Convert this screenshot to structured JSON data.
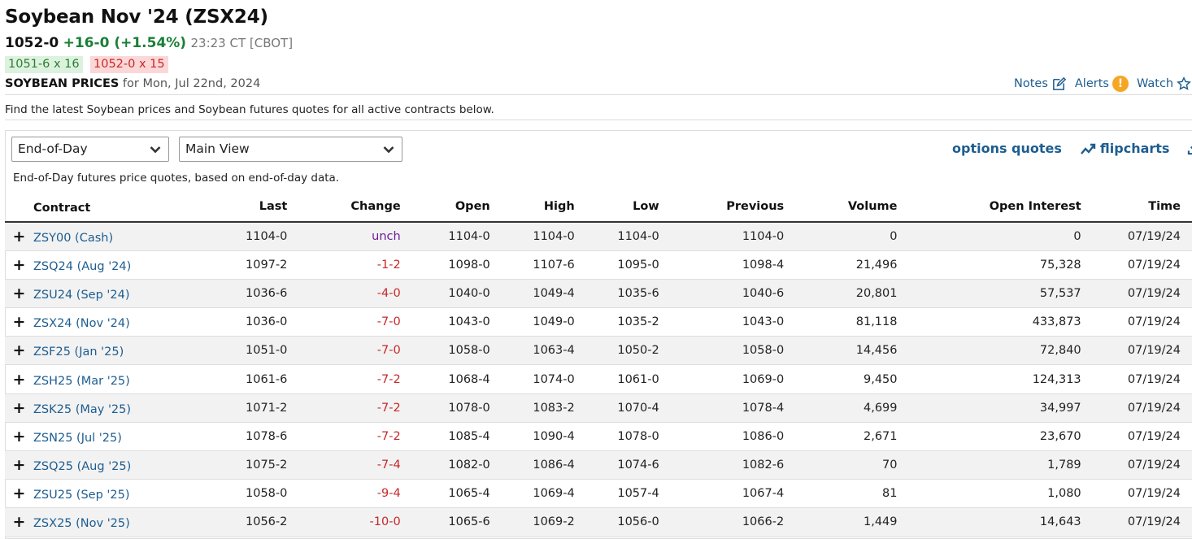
{
  "header": {
    "title": "Soybean Nov '24 (ZSX24)",
    "last": "1052-0",
    "change": "+16-0 (+1.54%)",
    "time": "23:23 CT [CBOT]",
    "bid": "1051-6 x 16",
    "ask": "1052-0 x 15",
    "prices_label": "SOYBEAN PRICES",
    "prices_date": "for Mon, Jul 22nd, 2024"
  },
  "actions": {
    "notes": "Notes",
    "alerts": "Alerts",
    "alerts_badge": "!",
    "watch": "Watch"
  },
  "intro": "Find the latest Soybean prices and Soybean futures quotes for all active contracts below.",
  "controls": {
    "data_select": "End-of-Day",
    "view_select": "Main View",
    "options_quotes": "options quotes",
    "flipcharts": "flipcharts",
    "download": "d"
  },
  "description": "End-of-Day futures price quotes, based on end-of-day data.",
  "colors": {
    "link": "#1d5d90",
    "negative": "#c62828",
    "positive": "#1a7f37",
    "unch": "#6a1b9a"
  },
  "table": {
    "headers": [
      "Contract",
      "Last",
      "Change",
      "Open",
      "High",
      "Low",
      "Previous",
      "Volume",
      "Open Interest",
      "Time"
    ],
    "rows": [
      {
        "contract": "ZSY00 (Cash)",
        "last": "1104-0",
        "change": "unch",
        "open": "1104-0",
        "high": "1104-0",
        "low": "1104-0",
        "previous": "1104-0",
        "volume": "0",
        "open_interest": "0",
        "time": "07/19/24"
      },
      {
        "contract": "ZSQ24 (Aug '24)",
        "last": "1097-2",
        "change": "-1-2",
        "open": "1098-0",
        "high": "1107-6",
        "low": "1095-0",
        "previous": "1098-4",
        "volume": "21,496",
        "open_interest": "75,328",
        "time": "07/19/24"
      },
      {
        "contract": "ZSU24 (Sep '24)",
        "last": "1036-6",
        "change": "-4-0",
        "open": "1040-0",
        "high": "1049-4",
        "low": "1035-6",
        "previous": "1040-6",
        "volume": "20,801",
        "open_interest": "57,537",
        "time": "07/19/24"
      },
      {
        "contract": "ZSX24 (Nov '24)",
        "last": "1036-0",
        "change": "-7-0",
        "open": "1043-0",
        "high": "1049-0",
        "low": "1035-2",
        "previous": "1043-0",
        "volume": "81,118",
        "open_interest": "433,873",
        "time": "07/19/24"
      },
      {
        "contract": "ZSF25 (Jan '25)",
        "last": "1051-0",
        "change": "-7-0",
        "open": "1058-0",
        "high": "1063-4",
        "low": "1050-2",
        "previous": "1058-0",
        "volume": "14,456",
        "open_interest": "72,840",
        "time": "07/19/24"
      },
      {
        "contract": "ZSH25 (Mar '25)",
        "last": "1061-6",
        "change": "-7-2",
        "open": "1068-4",
        "high": "1074-0",
        "low": "1061-0",
        "previous": "1069-0",
        "volume": "9,450",
        "open_interest": "124,313",
        "time": "07/19/24"
      },
      {
        "contract": "ZSK25 (May '25)",
        "last": "1071-2",
        "change": "-7-2",
        "open": "1078-0",
        "high": "1083-2",
        "low": "1070-4",
        "previous": "1078-4",
        "volume": "4,699",
        "open_interest": "34,997",
        "time": "07/19/24"
      },
      {
        "contract": "ZSN25 (Jul '25)",
        "last": "1078-6",
        "change": "-7-2",
        "open": "1085-4",
        "high": "1090-4",
        "low": "1078-0",
        "previous": "1086-0",
        "volume": "2,671",
        "open_interest": "23,670",
        "time": "07/19/24"
      },
      {
        "contract": "ZSQ25 (Aug '25)",
        "last": "1075-2",
        "change": "-7-4",
        "open": "1082-0",
        "high": "1086-4",
        "low": "1074-6",
        "previous": "1082-6",
        "volume": "70",
        "open_interest": "1,789",
        "time": "07/19/24"
      },
      {
        "contract": "ZSU25 (Sep '25)",
        "last": "1058-0",
        "change": "-9-4",
        "open": "1065-4",
        "high": "1069-4",
        "low": "1057-4",
        "previous": "1067-4",
        "volume": "81",
        "open_interest": "1,080",
        "time": "07/19/24"
      },
      {
        "contract": "ZSX25 (Nov '25)",
        "last": "1056-2",
        "change": "-10-0",
        "open": "1065-6",
        "high": "1069-2",
        "low": "1056-0",
        "previous": "1066-2",
        "volume": "1,449",
        "open_interest": "14,643",
        "time": "07/19/24"
      }
    ]
  }
}
